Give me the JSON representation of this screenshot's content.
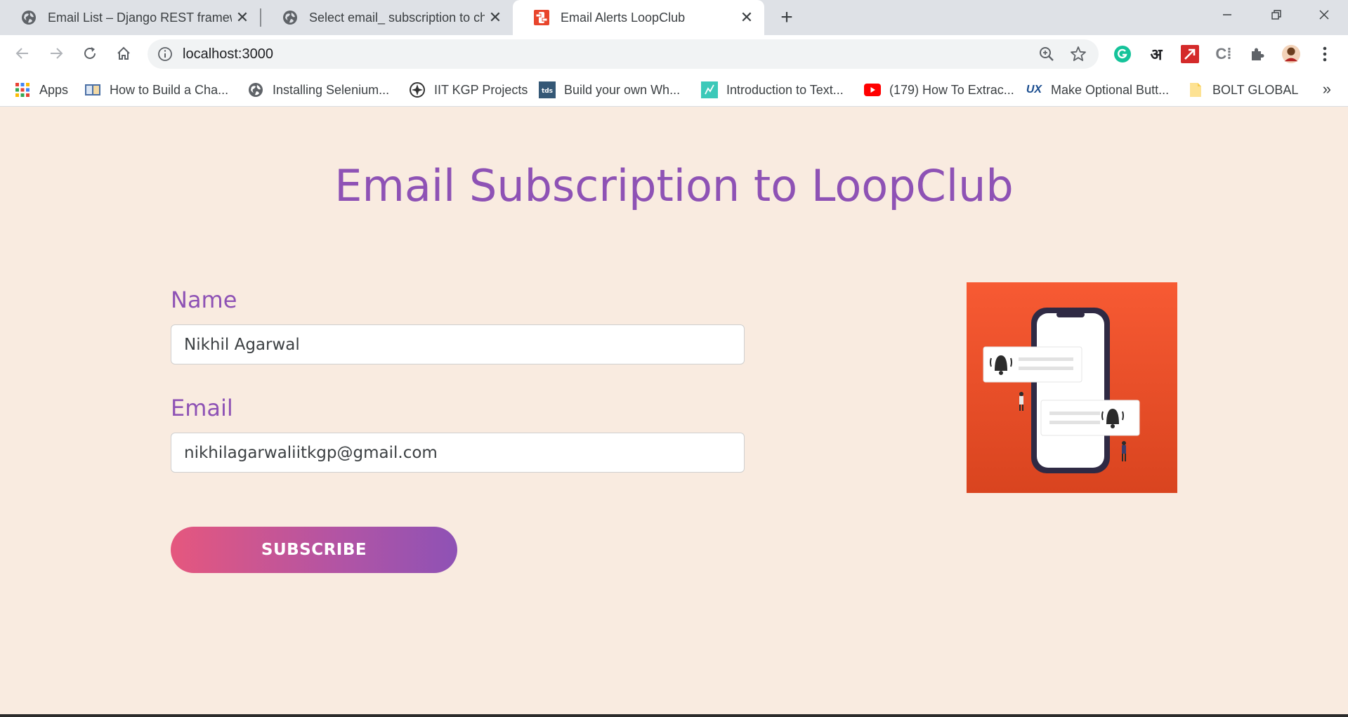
{
  "browser": {
    "tabs": [
      {
        "title": "Email List – Django REST framework",
        "icon": "globe-icon",
        "active": false
      },
      {
        "title": "Select email_ subscription to change",
        "icon": "globe-icon",
        "active": false
      },
      {
        "title": "Email Alerts LoopClub",
        "icon": "loopclub-favicon",
        "active": true
      }
    ],
    "url": "localhost:3000",
    "bookmarks": [
      {
        "label": "Apps",
        "icon": "apps-grid-icon"
      },
      {
        "label": "How to Build a Cha...",
        "icon": "book-icon"
      },
      {
        "label": "Installing Selenium...",
        "icon": "globe-icon"
      },
      {
        "label": "IIT KGP Projects",
        "icon": "iit-kgp-icon"
      },
      {
        "label": "Build your own Wh...",
        "icon": "tds-icon"
      },
      {
        "label": "Introduction to Text...",
        "icon": "teal-bookmark-icon"
      },
      {
        "label": "(179) How To Extrac...",
        "icon": "youtube-icon"
      },
      {
        "label": "Make Optional Butt...",
        "icon": "ux-icon"
      },
      {
        "label": "BOLT GLOBAL",
        "icon": "folder-icon"
      }
    ],
    "extensions": [
      "grammarly-icon",
      "hindi-icon",
      "red-arrow-icon",
      "c-extension-icon",
      "puzzle-icon",
      "profile-avatar",
      "menu-dots-icon"
    ]
  },
  "page": {
    "heading": "Email Subscription to LoopClub",
    "name_label": "Name",
    "name_value": "Nikhil Agarwal",
    "email_label": "Email",
    "email_value": "nikhilagarwaliitkgp@gmail.com",
    "subscribe_label": "SUBSCRIBE",
    "illustration": "phone-notification-illustration"
  },
  "colors": {
    "page_background": "#f9ebe0",
    "accent_purple": "#8e52b5",
    "button_gradient_start": "#e5577e",
    "button_gradient_end": "#8e52b5",
    "illustration_orange": "#f2542d"
  }
}
